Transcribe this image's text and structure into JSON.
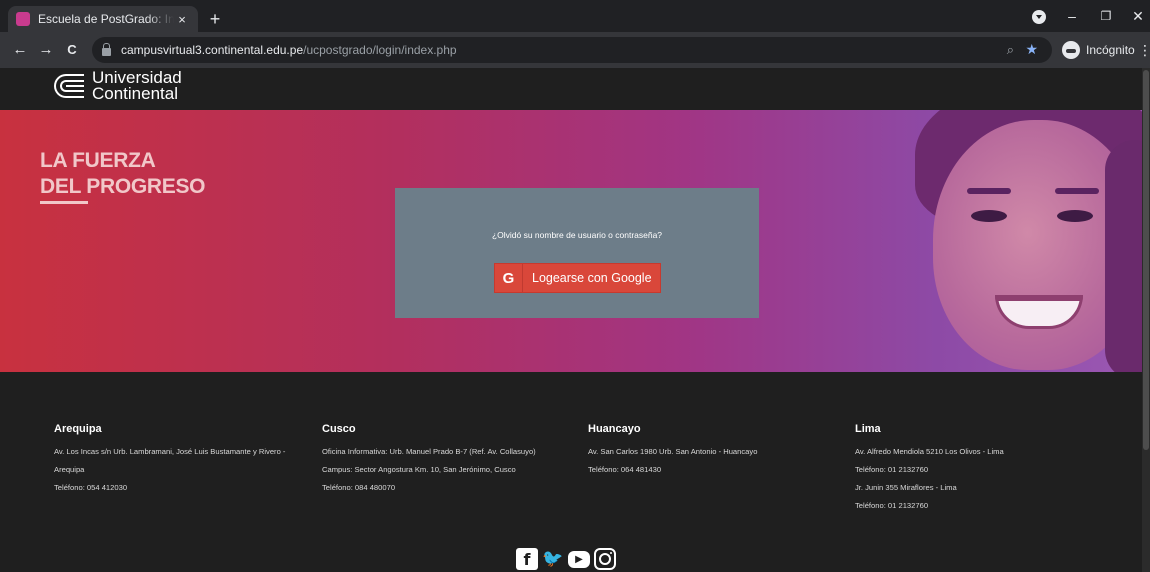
{
  "browser": {
    "tab_title": "Escuela de PostGrado: Iniciar sesi",
    "tab_close": "×",
    "new_tab": "+",
    "url_host": "campusvirtual3.continental.edu.pe",
    "url_path": "/ucpostgrado/login/index.php",
    "incognito_label": "Incógnito",
    "back": "←",
    "forward": "→",
    "reload": "C",
    "minimize": "–",
    "maximize": "❐",
    "close": "✕",
    "zoom_icon": "⌕",
    "star_icon": "★",
    "menu": "⋮"
  },
  "header": {
    "logo_line1": "Universidad",
    "logo_line2": "Continental"
  },
  "hero": {
    "title_line1": "LA FUERZA",
    "title_line2": "DEL PROGRESO"
  },
  "login": {
    "forgot_text": "¿Olvidó su nombre de usuario o contraseña?",
    "google_icon_letter": "G",
    "google_button_label": "Logearse con Google"
  },
  "footer": {
    "offices": [
      {
        "name": "Arequipa",
        "lines": [
          "Av. Los Incas s/n Urb. Lambramani, José Luis Bustamante y Rivero -",
          "Arequipa",
          "Teléfono: 054 412030"
        ]
      },
      {
        "name": "Cusco",
        "lines": [
          "Oficina Informativa: Urb. Manuel Prado B-7 (Ref. Av. Collasuyo)",
          "Campus: Sector Angostura Km. 10, San Jerónimo, Cusco",
          "Teléfono: 084 480070"
        ]
      },
      {
        "name": "Huancayo",
        "lines": [
          "Av. San Carlos 1980 Urb. San Antonio - Huancayo",
          "Teléfono: 064 481430"
        ]
      },
      {
        "name": "Lima",
        "lines": [
          "Av. Alfredo Mendiola 5210 Los Olivos - Lima",
          "Teléfono: 01 2132760",
          "Jr. Junin 355 Miraflores - Lima",
          "Teléfono: 01 2132760"
        ]
      }
    ],
    "social": {
      "facebook_glyph": "f",
      "twitter_glyph": "🐦",
      "youtube_glyph": "▶"
    }
  }
}
